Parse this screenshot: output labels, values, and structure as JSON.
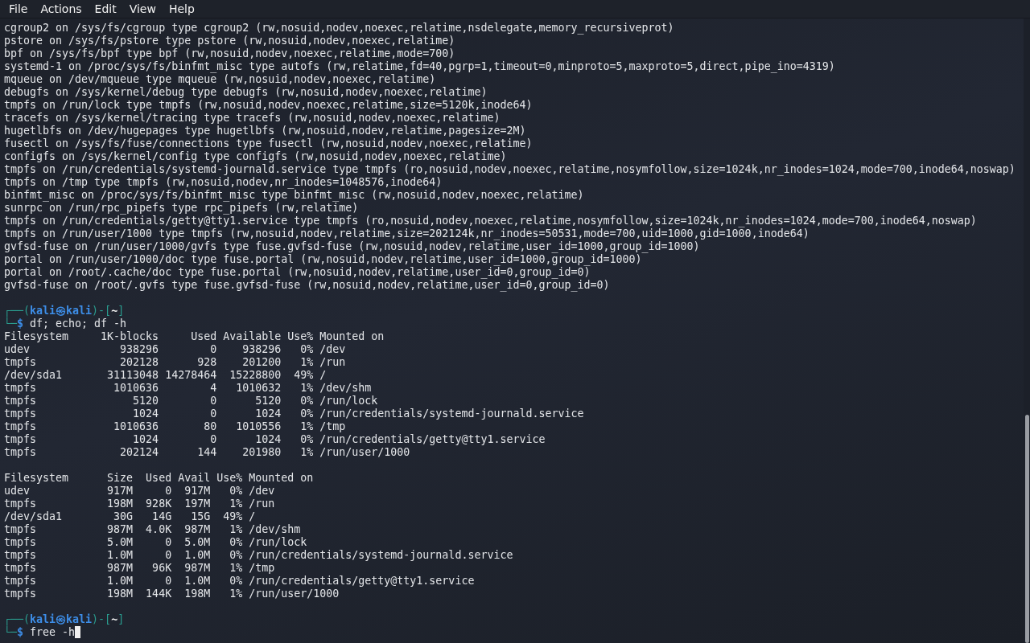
{
  "menu": [
    {
      "label": "File"
    },
    {
      "label": "Actions"
    },
    {
      "label": "Edit"
    },
    {
      "label": "View"
    },
    {
      "label": "Help"
    }
  ],
  "lines": [
    {
      "kind": "text",
      "text": "cgroup2 on /sys/fs/cgroup type cgroup2 (rw,nosuid,nodev,noexec,relatime,nsdelegate,memory_recursiveprot)"
    },
    {
      "kind": "text",
      "text": "pstore on /sys/fs/pstore type pstore (rw,nosuid,nodev,noexec,relatime)"
    },
    {
      "kind": "text",
      "text": "bpf on /sys/fs/bpf type bpf (rw,nosuid,nodev,noexec,relatime,mode=700)"
    },
    {
      "kind": "text",
      "text": "systemd-1 on /proc/sys/fs/binfmt_misc type autofs (rw,relatime,fd=40,pgrp=1,timeout=0,minproto=5,maxproto=5,direct,pipe_ino=4319)"
    },
    {
      "kind": "text",
      "text": "mqueue on /dev/mqueue type mqueue (rw,nosuid,nodev,noexec,relatime)"
    },
    {
      "kind": "text",
      "text": "debugfs on /sys/kernel/debug type debugfs (rw,nosuid,nodev,noexec,relatime)"
    },
    {
      "kind": "text",
      "text": "tmpfs on /run/lock type tmpfs (rw,nosuid,nodev,noexec,relatime,size=5120k,inode64)"
    },
    {
      "kind": "text",
      "text": "tracefs on /sys/kernel/tracing type tracefs (rw,nosuid,nodev,noexec,relatime)"
    },
    {
      "kind": "text",
      "text": "hugetlbfs on /dev/hugepages type hugetlbfs (rw,nosuid,nodev,relatime,pagesize=2M)"
    },
    {
      "kind": "text",
      "text": "fusectl on /sys/fs/fuse/connections type fusectl (rw,nosuid,nodev,noexec,relatime)"
    },
    {
      "kind": "text",
      "text": "configfs on /sys/kernel/config type configfs (rw,nosuid,nodev,noexec,relatime)"
    },
    {
      "kind": "text",
      "text": "tmpfs on /run/credentials/systemd-journald.service type tmpfs (ro,nosuid,nodev,noexec,relatime,nosymfollow,size=1024k,nr_inodes=1024,mode=700,inode64,noswap)"
    },
    {
      "kind": "text",
      "text": "tmpfs on /tmp type tmpfs (rw,nosuid,nodev,nr_inodes=1048576,inode64)"
    },
    {
      "kind": "text",
      "text": "binfmt_misc on /proc/sys/fs/binfmt_misc type binfmt_misc (rw,nosuid,nodev,noexec,relatime)"
    },
    {
      "kind": "text",
      "text": "sunrpc on /run/rpc_pipefs type rpc_pipefs (rw,relatime)"
    },
    {
      "kind": "text",
      "text": "tmpfs on /run/credentials/getty@tty1.service type tmpfs (ro,nosuid,nodev,noexec,relatime,nosymfollow,size=1024k,nr_inodes=1024,mode=700,inode64,noswap)"
    },
    {
      "kind": "text",
      "text": "tmpfs on /run/user/1000 type tmpfs (rw,nosuid,nodev,relatime,size=202124k,nr_inodes=50531,mode=700,uid=1000,gid=1000,inode64)"
    },
    {
      "kind": "text",
      "text": "gvfsd-fuse on /run/user/1000/gvfs type fuse.gvfsd-fuse (rw,nosuid,nodev,relatime,user_id=1000,group_id=1000)"
    },
    {
      "kind": "text",
      "text": "portal on /run/user/1000/doc type fuse.portal (rw,nosuid,nodev,relatime,user_id=1000,group_id=1000)"
    },
    {
      "kind": "text",
      "text": "portal on /root/.cache/doc type fuse.portal (rw,nosuid,nodev,relatime,user_id=0,group_id=0)"
    },
    {
      "kind": "text",
      "text": "gvfsd-fuse on /root/.gvfs type fuse.gvfsd-fuse (rw,nosuid,nodev,relatime,user_id=0,group_id=0)"
    },
    {
      "kind": "blank"
    },
    {
      "kind": "prompt",
      "open": "┌──(",
      "user": "kali",
      "at": "㉿",
      "host": "kali",
      "mid": ")-[",
      "dir": "~",
      "close": "]",
      "corner": "└─",
      "symbol": "$",
      "command": "df; echo; df -h",
      "cursor": false
    },
    {
      "kind": "text",
      "text": "Filesystem     1K-blocks     Used Available Use% Mounted on"
    },
    {
      "kind": "text",
      "text": "udev              938296        0    938296   0% /dev"
    },
    {
      "kind": "text",
      "text": "tmpfs             202128      928    201200   1% /run"
    },
    {
      "kind": "text",
      "text": "/dev/sda1       31113048 14278464  15228800  49% /"
    },
    {
      "kind": "text",
      "text": "tmpfs            1010636        4   1010632   1% /dev/shm"
    },
    {
      "kind": "text",
      "text": "tmpfs               5120        0      5120   0% /run/lock"
    },
    {
      "kind": "text",
      "text": "tmpfs               1024        0      1024   0% /run/credentials/systemd-journald.service"
    },
    {
      "kind": "text",
      "text": "tmpfs            1010636       80   1010556   1% /tmp"
    },
    {
      "kind": "text",
      "text": "tmpfs               1024        0      1024   0% /run/credentials/getty@tty1.service"
    },
    {
      "kind": "text",
      "text": "tmpfs             202124      144    201980   1% /run/user/1000"
    },
    {
      "kind": "blank"
    },
    {
      "kind": "text",
      "text": "Filesystem      Size  Used Avail Use% Mounted on"
    },
    {
      "kind": "text",
      "text": "udev            917M     0  917M   0% /dev"
    },
    {
      "kind": "text",
      "text": "tmpfs           198M  928K  197M   1% /run"
    },
    {
      "kind": "text",
      "text": "/dev/sda1        30G   14G   15G  49% /"
    },
    {
      "kind": "text",
      "text": "tmpfs           987M  4.0K  987M   1% /dev/shm"
    },
    {
      "kind": "text",
      "text": "tmpfs           5.0M     0  5.0M   0% /run/lock"
    },
    {
      "kind": "text",
      "text": "tmpfs           1.0M     0  1.0M   0% /run/credentials/systemd-journald.service"
    },
    {
      "kind": "text",
      "text": "tmpfs           987M   96K  987M   1% /tmp"
    },
    {
      "kind": "text",
      "text": "tmpfs           1.0M     0  1.0M   0% /run/credentials/getty@tty1.service"
    },
    {
      "kind": "text",
      "text": "tmpfs           198M  144K  198M   1% /run/user/1000"
    },
    {
      "kind": "blank"
    },
    {
      "kind": "prompt",
      "open": "┌──(",
      "user": "kali",
      "at": "㉿",
      "host": "kali",
      "mid": ")-[",
      "dir": "~",
      "close": "]",
      "corner": "└─",
      "symbol": "$",
      "command": "free -h",
      "cursor": true
    }
  ]
}
